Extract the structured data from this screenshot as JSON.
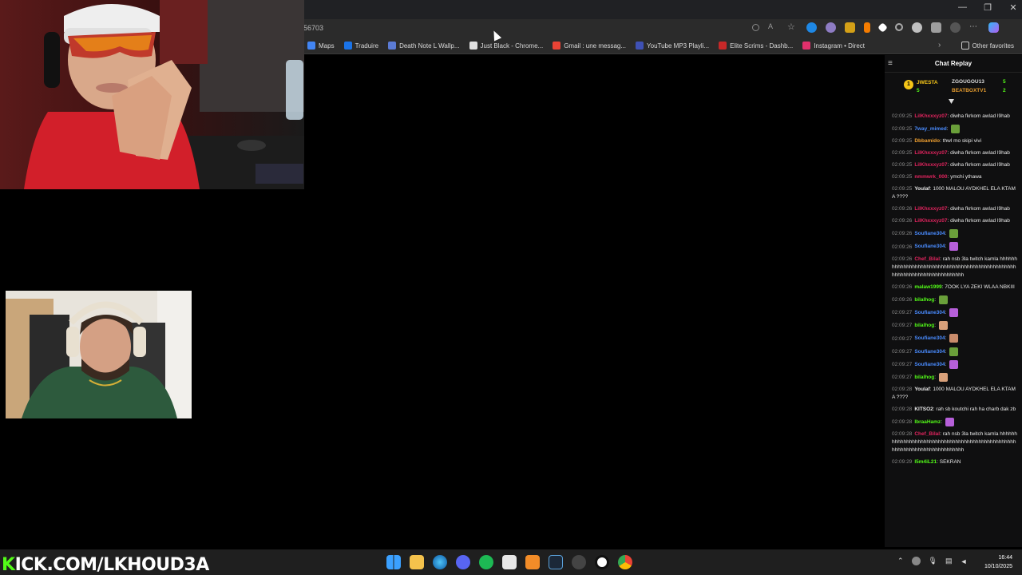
{
  "browser": {
    "url_fragment": "56703",
    "window_controls": [
      "—",
      "❐",
      "✕"
    ],
    "bookmarks": [
      {
        "label": "Maps",
        "color": "#4285f4"
      },
      {
        "label": "Traduire",
        "color": "#1a73e8"
      },
      {
        "label": "Death Note L Wallp...",
        "color": "#5b7bd5"
      },
      {
        "label": "Just Black - Chrome...",
        "color": "#e0e0e0"
      },
      {
        "label": "Gmail : une messag...",
        "color": "#ea4335"
      },
      {
        "label": "YouTube MP3 Playli...",
        "color": "#3f51b5"
      },
      {
        "label": "Elite Scrims - Dashb...",
        "color": "#c62828"
      },
      {
        "label": "Instagram • Direct",
        "color": "#e1306c"
      }
    ],
    "other_favorites": "Other favorites"
  },
  "chat": {
    "title": "Chat Replay",
    "leaderboard": {
      "rank": "1",
      "first": {
        "name": "JWESTA",
        "count": "5"
      },
      "second": {
        "name": "ZGOUGOU13",
        "count": "5"
      },
      "third": {
        "name": "BEATBOXTV1",
        "count": "2"
      }
    },
    "messages": [
      {
        "time": "02:09:25",
        "user": "LilKhxxxyz07",
        "color": "#e0245e",
        "text": "diwha fkrkom awlad l9hab"
      },
      {
        "time": "02:09:25",
        "user": "7way_mimed",
        "color": "#4a8cff",
        "text": ""
      },
      {
        "time": "02:09:25",
        "user": "Dbbamido",
        "color": "#f0a030",
        "text": "thwl mo skipi vivi"
      },
      {
        "time": "02:09:25",
        "user": "LilKhxxxyz07",
        "color": "#e0245e",
        "text": "diwha fkrkom awlad l9hab"
      },
      {
        "time": "02:09:25",
        "user": "LilKhxxxyz07",
        "color": "#e0245e",
        "text": "diwha fkrkom awlad l9hab"
      },
      {
        "time": "02:09:25",
        "user": "nmmwrk_000",
        "color": "#e0245e",
        "text": "ymchi ythawa"
      },
      {
        "time": "02:09:25",
        "user": "Youlaf",
        "color": "#e8e8e8",
        "text": "1000 MALOU AYDKHEL ELA KTAMA ????"
      },
      {
        "time": "02:09:26",
        "user": "LilKhxxxyz07",
        "color": "#e0245e",
        "text": "diwha fkrkom awlad l9hab"
      },
      {
        "time": "02:09:26",
        "user": "LilKhxxxyz07",
        "color": "#e0245e",
        "text": "diwha fkrkom awlad l9hab"
      },
      {
        "time": "02:09:26",
        "user": "Soufiane304",
        "color": "#4a8cff",
        "text": ""
      },
      {
        "time": "02:09:26",
        "user": "Soufiane304",
        "color": "#4a8cff",
        "text": ""
      },
      {
        "time": "02:09:26",
        "user": "Chef_Bilal",
        "color": "#e0245e",
        "text": "rah nsb 3la twitch kamla hhhhhhhhhhhhhhhhhhhhhhhhhhhhhhhhhhhhhhhhhhhhhhhhhhhhhhhhhhhhhhhhhhhhhhhhhh"
      },
      {
        "time": "02:09:26",
        "user": "malaw1999",
        "color": "#53fc18",
        "text": "7OOK LYA ZEKI WLAA NBKIII"
      },
      {
        "time": "02:09:26",
        "user": "bilalhog",
        "color": "#53fc18",
        "text": ""
      },
      {
        "time": "02:09:27",
        "user": "Soufiane304",
        "color": "#4a8cff",
        "text": ""
      },
      {
        "time": "02:09:27",
        "user": "bilalhog",
        "color": "#53fc18",
        "text": ""
      },
      {
        "time": "02:09:27",
        "user": "Soufiane304",
        "color": "#4a8cff",
        "text": ""
      },
      {
        "time": "02:09:27",
        "user": "Soufiane304",
        "color": "#4a8cff",
        "text": ""
      },
      {
        "time": "02:09:27",
        "user": "Soufiane304",
        "color": "#4a8cff",
        "text": ""
      },
      {
        "time": "02:09:27",
        "user": "bilalhog",
        "color": "#53fc18",
        "text": ""
      },
      {
        "time": "02:09:28",
        "user": "Youlaf",
        "color": "#e8e8e8",
        "text": "1000 MALOU AYDKHEL ELA KTAMA ????"
      },
      {
        "time": "02:09:28",
        "user": "KITSO2",
        "color": "#e8e8e8",
        "text": "rah sb koutchi rah ha charb dak zb"
      },
      {
        "time": "02:09:28",
        "user": "IbraaHamz",
        "color": "#53fc18",
        "text": ""
      },
      {
        "time": "02:09:28",
        "user": "Chef_Bilal",
        "color": "#e0245e",
        "text": "rah nsb 3la twitch kamla hhhhhhhhhhhhhhhhhhhhhhhhhhhhhhhhhhhhhhhhhhhhhhhhhhhhhhhhhhhhhhhhhhhhhhhhhh"
      },
      {
        "time": "02:09:29",
        "user": "l5m4iL21",
        "color": "#53fc18",
        "text": "SEKRAN"
      }
    ]
  },
  "overlay": {
    "kick_prefix": "K",
    "kick_rest": "ICK.COM/LKHOUD3A"
  },
  "taskbar": {
    "time": "16:44",
    "date": "10/10/2025"
  }
}
